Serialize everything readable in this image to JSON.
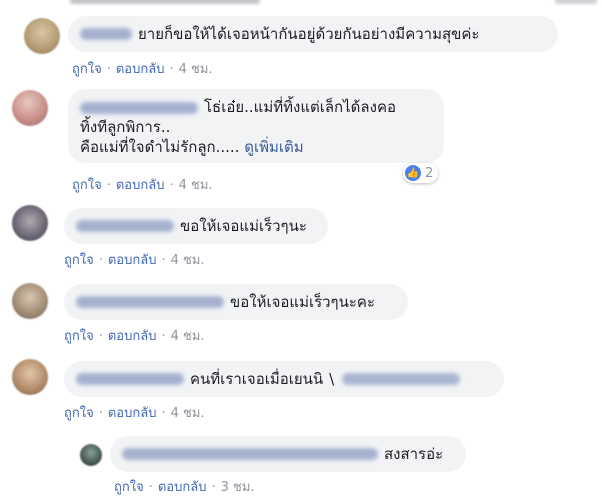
{
  "ui": {
    "like_label": "ถูกใจ",
    "reply_label": "ตอบกลับ",
    "separator": "·"
  },
  "comments": [
    {
      "text": "ยายก็ขอให้ได้เจอหน้ากันอยู่ด้วยกันอย่างมีความสุขค่ะ",
      "time": "4 ชม."
    },
    {
      "text_line1": "โธ่เอ๋ย..แม่ที่ทิ้งแต่เล็กได้ลงคอ",
      "text_line2": "ทิ้งทีลูกพิการ..",
      "text_line3": "คือแม่ที่ใจดำไม่รักลูก.....",
      "see_more": "ดูเพิ่มเติม",
      "reaction_count": "2",
      "time": "4 ชม."
    },
    {
      "text": "ขอให้เจอแม่เร็วๆนะ",
      "time": "4 ชม."
    },
    {
      "text": "ขอให้เจอแม่เร็วๆนะคะ",
      "time": "4 ชม."
    },
    {
      "text": "คนที่เราเจอเมื่อเยนนิ",
      "time": "4 ชม."
    },
    {
      "text": "สงสารอ่ะ",
      "time": "3 ชม."
    }
  ],
  "colors": {
    "bubble_bg": "#f2f3f5",
    "link": "#4267b2",
    "meta": "#90949c",
    "like_blue": "#4c7df1"
  }
}
